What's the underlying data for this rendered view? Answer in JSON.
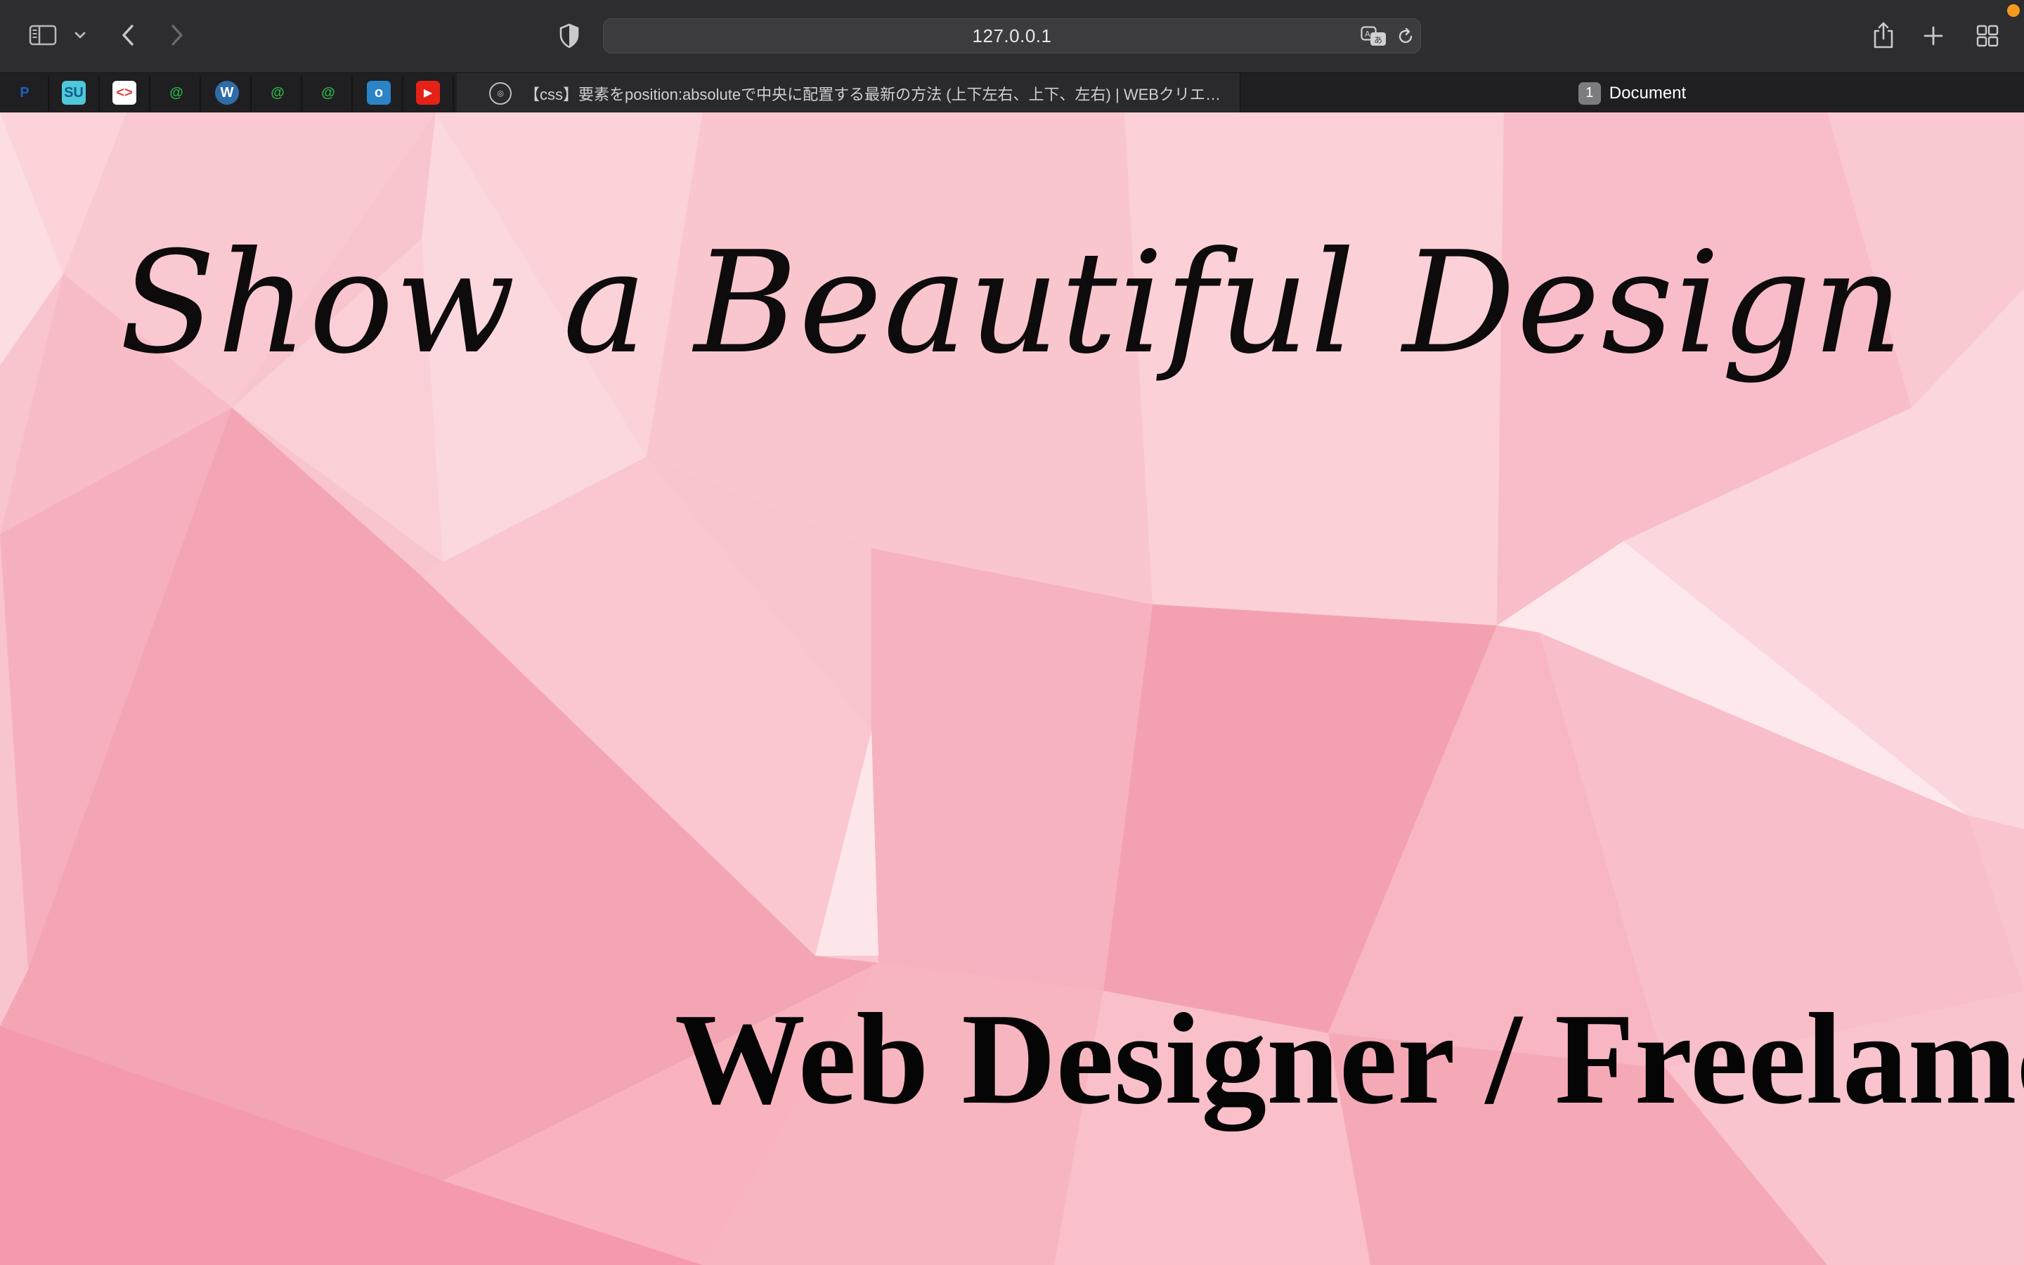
{
  "browser": {
    "address": "127.0.0.1",
    "active_tab": {
      "title": "Document",
      "badge": "1"
    },
    "inactive_tab": {
      "title": "【css】要素をposition:absoluteで中央に配置する最新の方法 (上下左右、上下、左右) | WEBクリエイタ…"
    },
    "favorites": [
      {
        "name": "paypal",
        "glyph": "P",
        "color": "#1f5fbf",
        "bg": "transparent"
      },
      {
        "name": "su",
        "glyph": "SU",
        "color": "#0f5b8f",
        "bg": "#4fc8d9"
      },
      {
        "name": "code",
        "glyph": "<>",
        "color": "#e0463c",
        "bg": "#ffffff"
      },
      {
        "name": "cloud-1",
        "glyph": "@",
        "color": "#2bb24c",
        "bg": "transparent"
      },
      {
        "name": "wordpress",
        "glyph": "W",
        "color": "#ffffff",
        "bg": "#2f6ca8"
      },
      {
        "name": "cloud-2",
        "glyph": "@",
        "color": "#2bb24c",
        "bg": "transparent"
      },
      {
        "name": "cloud-3",
        "glyph": "@",
        "color": "#2bb24c",
        "bg": "transparent"
      },
      {
        "name": "app",
        "glyph": "o",
        "color": "#ffffff",
        "bg": "#2a84c6"
      },
      {
        "name": "youtube",
        "glyph": "▶",
        "color": "#ffffff",
        "bg": "#e62117"
      }
    ]
  },
  "page": {
    "hero_title": "Show a Beautiful Design",
    "subtitle": "Web Designer / Freelamce"
  },
  "colors": {
    "toolbar_bg": "#2d2c2f",
    "tabbar_bg": "#1f1f21",
    "page_bg": "#f8c6cf",
    "notification_dot": "#f39a1f"
  }
}
